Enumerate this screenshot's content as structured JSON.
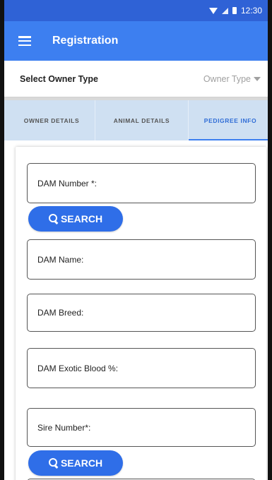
{
  "status_bar": {
    "time": "12:30"
  },
  "app_bar": {
    "title": "Registration",
    "menu_icon": "hamburger-menu-icon"
  },
  "owner_type": {
    "label": "Select Owner Type",
    "placeholder": "Owner Type"
  },
  "tabs": [
    {
      "label": "OWNER DETAILS",
      "active": false
    },
    {
      "label": "ANIMAL DETAILS",
      "active": false
    },
    {
      "label": "PEDIGREE INFO",
      "active": true
    }
  ],
  "form": {
    "dam_number_label": "DAM Number *:",
    "search_label_1": "SEARCH",
    "dam_name_label": "DAM Name:",
    "dam_breed_label": "DAM Breed:",
    "dam_exotic_blood_label": "DAM Exotic Blood %:",
    "sire_number_label": "Sire Number*:",
    "search_label_2": "SEARCH"
  },
  "colors": {
    "status_bar": "#2f62d6",
    "app_bar": "#3d7ff0",
    "tab_bar": "#cfe0f2",
    "active_tab": "#2f6cd6",
    "search_button": "#2f6ee8"
  }
}
